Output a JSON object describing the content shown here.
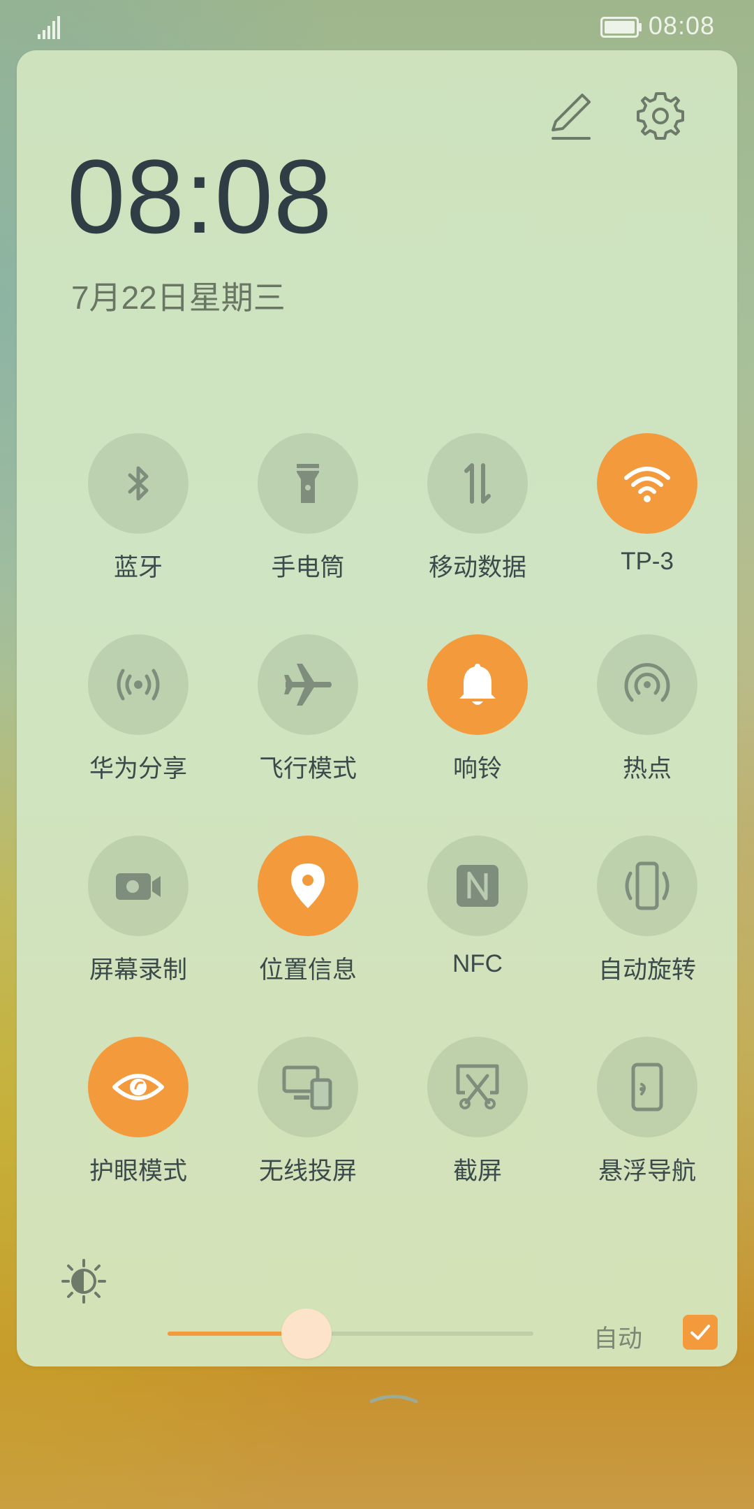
{
  "status_bar": {
    "time": "08:08",
    "signal_icon": "signal-icon",
    "battery_icon": "battery-icon"
  },
  "header": {
    "clock": "08:08",
    "date": "7月22日星期三",
    "edit_icon": "edit-icon",
    "settings_icon": "gear-icon"
  },
  "tiles": [
    {
      "label": "蓝牙",
      "icon": "bluetooth-icon",
      "active": false
    },
    {
      "label": "手电筒",
      "icon": "flashlight-icon",
      "active": false
    },
    {
      "label": "移动数据",
      "icon": "mobile-data-icon",
      "active": false
    },
    {
      "label": "TP-3",
      "icon": "wifi-icon",
      "active": true
    },
    {
      "label": "华为分享",
      "icon": "share-icon",
      "active": false
    },
    {
      "label": "飞行模式",
      "icon": "airplane-icon",
      "active": false
    },
    {
      "label": "响铃",
      "icon": "bell-icon",
      "active": true
    },
    {
      "label": "热点",
      "icon": "hotspot-icon",
      "active": false
    },
    {
      "label": "屏幕录制",
      "icon": "screen-record-icon",
      "active": false
    },
    {
      "label": "位置信息",
      "icon": "location-icon",
      "active": true
    },
    {
      "label": "NFC",
      "icon": "nfc-icon",
      "active": false
    },
    {
      "label": "自动旋转",
      "icon": "auto-rotate-icon",
      "active": false
    },
    {
      "label": "护眼模式",
      "icon": "eye-icon",
      "active": true
    },
    {
      "label": "无线投屏",
      "icon": "wireless-projection-icon",
      "active": false
    },
    {
      "label": "截屏",
      "icon": "screenshot-icon",
      "active": false
    },
    {
      "label": "悬浮导航",
      "icon": "floating-nav-icon",
      "active": false
    }
  ],
  "brightness": {
    "level": 0.38,
    "auto_label": "自动",
    "auto_checked": true
  },
  "colors": {
    "accent": "#f39a3c",
    "inactive_circle": "#b9cbb0",
    "icon_inactive": "#7f8e7c",
    "text": "#3b4a4a"
  }
}
